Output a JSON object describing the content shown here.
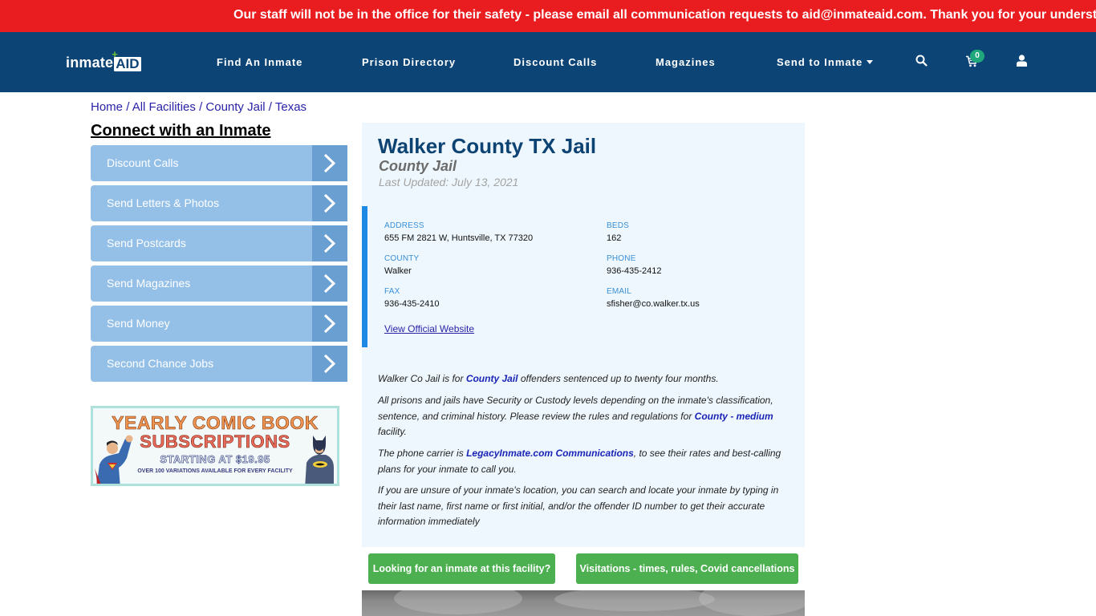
{
  "alert": {
    "text": "Our staff will not be in the office for their safety - please email all communication requests to aid@inmateaid.com. Thank you for your understanding."
  },
  "navbar": {
    "logo": {
      "part1": "inmate",
      "part2": "AID",
      "plus": "+"
    },
    "items": [
      {
        "label": "Find An Inmate"
      },
      {
        "label": "Prison Directory"
      },
      {
        "label": "Discount Calls"
      },
      {
        "label": "Magazines"
      },
      {
        "label": "Send to Inmate",
        "dropdown": true
      }
    ],
    "icons": {
      "search": "search-icon",
      "cart": "cart-icon",
      "user": "user-icon"
    },
    "cart_count": "0",
    "colors": {
      "bar": "#0c4476",
      "badge": "#1fa87c"
    }
  },
  "breadcrumb": {
    "items": [
      "Home",
      "All Facilities",
      "County Jail",
      "Texas"
    ],
    "separator": "/"
  },
  "sidebar": {
    "title": "Connect with an Inmate",
    "buttons": [
      {
        "label": "Discount Calls"
      },
      {
        "label": "Send Letters & Photos"
      },
      {
        "label": "Send Postcards"
      },
      {
        "label": "Send Magazines"
      },
      {
        "label": "Send Money"
      },
      {
        "label": "Second Chance Jobs"
      }
    ],
    "ad": {
      "line1": "YEARLY COMIC BOOK",
      "line2": "SUBSCRIPTIONS",
      "line3": "STARTING AT $19.95",
      "line4": "OVER 100 VARIATIONS AVAILABLE FOR EVERY FACILITY"
    }
  },
  "facility": {
    "title": "Walker County TX Jail",
    "type": "County Jail",
    "last_updated": "Last Updated: July 13, 2021",
    "fields": {
      "address": {
        "label": "ADDRESS",
        "value": "655 FM 2821 W, Huntsville, TX 77320"
      },
      "beds": {
        "label": "BEDS",
        "value": "162"
      },
      "county": {
        "label": "COUNTY",
        "value": "Walker"
      },
      "phone": {
        "label": "PHONE",
        "value": "936-435-2412"
      },
      "fax": {
        "label": "FAX",
        "value": "936-435-2410"
      },
      "email": {
        "label": "EMAIL",
        "value": "sfisher@co.walker.tx.us"
      }
    },
    "official_link": "View Official Website",
    "description": {
      "p1": {
        "pre": "Walker Co Jail is for ",
        "link": "County Jail",
        "post": " offenders sentenced up to twenty four months."
      },
      "p2": {
        "pre": "All prisons and jails have Security or Custody levels depending on the inmate's classification, sentence, and criminal history. Please review the rules and regulations for ",
        "link": "County - medium",
        "post": " facility."
      },
      "p3": {
        "pre": "The phone carrier is ",
        "link": "LegacyInmate.com Communications",
        "post": ", to see their rates and best-calling plans for your inmate to call you."
      },
      "p4": {
        "text": "If you are unsure of your inmate's location, you can search and locate your inmate by typing in their last name, first name or first initial, and/or the offender ID number to get their accurate information immediately"
      }
    }
  },
  "actions": {
    "find_inmate": "Looking for an inmate at this facility?",
    "visitations": "Visitations - times, rules, Covid cancellations"
  }
}
